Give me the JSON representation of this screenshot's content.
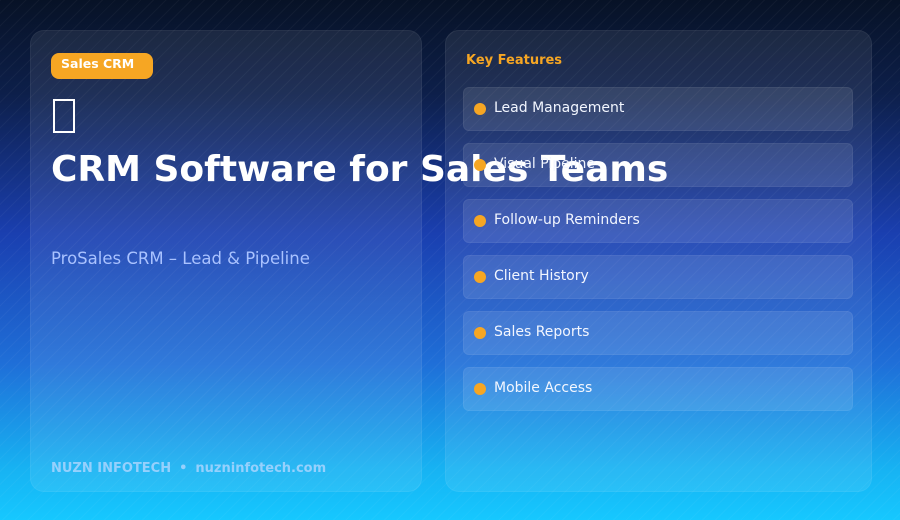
{
  "badge": "Sales CRM",
  "hero_icon": "broken-image-icon",
  "title": "CRM Software for Sales Teams",
  "subtitle": "ProSales CRM – Lead & Pipeline",
  "footer": {
    "company": "NUZN INFOTECH",
    "separator": "•",
    "website": "nuzninfotech.com"
  },
  "features": {
    "heading": "Key Features",
    "items": [
      "Lead Management",
      "Visual Pipeline",
      "Follow-up Reminders",
      "Client History",
      "Sales Reports",
      "Mobile Access"
    ]
  },
  "colors": {
    "accent": "#f6a623",
    "subtitle": "#a9c2ff"
  }
}
